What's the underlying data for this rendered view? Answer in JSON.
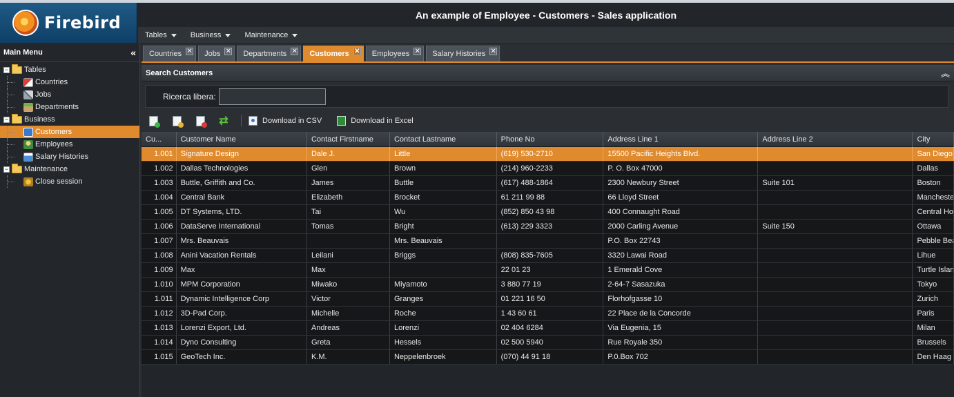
{
  "logo": {
    "text": "Firebird"
  },
  "header": {
    "title": "An example of Employee - Customers - Sales application"
  },
  "menubar": {
    "items": [
      "Tables",
      "Business",
      "Maintenance"
    ]
  },
  "sidebar": {
    "title": "Main Menu",
    "groups": [
      {
        "label": "Tables",
        "items": [
          "Countries",
          "Jobs",
          "Departments"
        ]
      },
      {
        "label": "Business",
        "items": [
          "Customers",
          "Employees",
          "Salary Histories"
        ]
      },
      {
        "label": "Maintenance",
        "items": [
          "Close session"
        ]
      }
    ],
    "selected": "Customers"
  },
  "tabs": [
    "Countries",
    "Jobs",
    "Departments",
    "Customers",
    "Employees",
    "Salary Histories"
  ],
  "active_tab": "Customers",
  "tab_close_glyph": "✕",
  "search": {
    "title": "Search Customers",
    "label": "Ricerca libera:",
    "value": "",
    "placeholder": ""
  },
  "toolbar": {
    "csv_label": "Download in CSV",
    "excel_label": "Download in Excel"
  },
  "grid": {
    "columns": [
      "Cu...",
      "Customer Name",
      "Contact Firstname",
      "Contact Lastname",
      "Phone No",
      "Address Line 1",
      "Address Line 2",
      "City"
    ],
    "rows": [
      [
        "1.001",
        "Signature Design",
        "Dale J.",
        "Little",
        "(619) 530-2710",
        "15500 Pacific Heights Blvd.",
        "",
        "San Diego"
      ],
      [
        "1.002",
        "Dallas Technologies",
        "Glen",
        "Brown",
        "(214) 960-2233",
        "P. O. Box 47000",
        "",
        "Dallas"
      ],
      [
        "1.003",
        "Buttle, Griffith and Co.",
        "James",
        "Buttle",
        "(617) 488-1864",
        "2300 Newbury Street",
        "Suite 101",
        "Boston"
      ],
      [
        "1.004",
        "Central Bank",
        "Elizabeth",
        "Brocket",
        "61 211 99 88",
        "66 Lloyd Street",
        "",
        "Manchester"
      ],
      [
        "1.005",
        "DT Systems, LTD.",
        "Tai",
        "Wu",
        "(852) 850 43 98",
        "400 Connaught Road",
        "",
        "Central Hong Kong"
      ],
      [
        "1.006",
        "DataServe International",
        "Tomas",
        "Bright",
        "(613) 229 3323",
        "2000 Carling Avenue",
        "Suite 150",
        "Ottawa"
      ],
      [
        "1.007",
        "Mrs. Beauvais",
        "",
        "Mrs. Beauvais",
        "",
        "P.O. Box 22743",
        "",
        "Pebble Beach"
      ],
      [
        "1.008",
        "Anini Vacation Rentals",
        "Leilani",
        "Briggs",
        "(808) 835-7605",
        "3320 Lawai Road",
        "",
        "Lihue"
      ],
      [
        "1.009",
        "Max",
        "Max",
        "",
        "22 01 23",
        "1 Emerald Cove",
        "",
        "Turtle Island"
      ],
      [
        "1.010",
        "MPM Corporation",
        "Miwako",
        "Miyamoto",
        "3 880 77 19",
        "2-64-7 Sasazuka",
        "",
        "Tokyo"
      ],
      [
        "1.011",
        "Dynamic Intelligence Corp",
        "Victor",
        "Granges",
        "01 221 16 50",
        "Florhofgasse 10",
        "",
        "Zurich"
      ],
      [
        "1.012",
        "3D-Pad Corp.",
        "Michelle",
        "Roche",
        "1 43 60 61",
        "22 Place de la Concorde",
        "",
        "Paris"
      ],
      [
        "1.013",
        "Lorenzi Export, Ltd.",
        "Andreas",
        "Lorenzi",
        "02 404 6284",
        "Via Eugenia, 15",
        "",
        "Milan"
      ],
      [
        "1.014",
        "Dyno Consulting",
        "Greta",
        "Hessels",
        "02 500 5940",
        "Rue Royale 350",
        "",
        "Brussels"
      ],
      [
        "1.015",
        "GeoTech Inc.",
        "K.M.",
        "Neppelenbroek",
        "(070) 44 91 18",
        "P.0.Box 702",
        "",
        "Den Haag"
      ]
    ],
    "selected_row": 0
  },
  "colors": {
    "accent": "#e08a2e",
    "background": "#2b2f33",
    "grid_row": "#151719"
  }
}
